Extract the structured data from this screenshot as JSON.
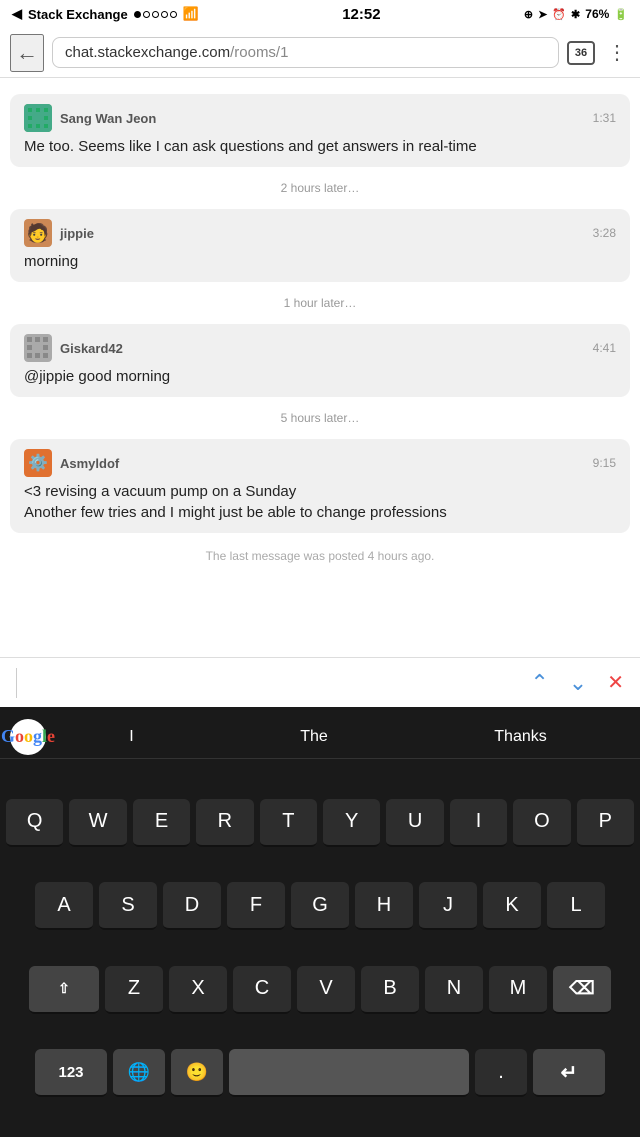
{
  "statusBar": {
    "app": "Stack Exchange",
    "signals": [
      "filled",
      "empty",
      "empty",
      "empty",
      "empty"
    ],
    "wifi": "wifi",
    "time": "12:52",
    "icons_right": [
      "location",
      "navigation",
      "alarm",
      "bluetooth"
    ],
    "battery": "76%"
  },
  "addressBar": {
    "back": "←",
    "url_main": "chat.stackexchange.com",
    "url_rest": "/rooms/1",
    "tab_count": "36",
    "menu": "⋮"
  },
  "chat": {
    "messages": [
      {
        "author": "Sang Wan Jeon",
        "time": "1:31",
        "avatar_type": "sang",
        "lines": [
          "Me too. Seems like I can ask questions and get answers in real-time"
        ]
      },
      {
        "separator": "2 hours later…"
      },
      {
        "author": "jippie",
        "time": "3:28",
        "avatar_type": "jippie",
        "lines": [
          "morning"
        ]
      },
      {
        "separator": "1 hour later…"
      },
      {
        "author": "Giskard42",
        "time": "4:41",
        "avatar_type": "giskard",
        "lines": [
          "@jippie good morning"
        ]
      },
      {
        "separator": "5 hours later…"
      },
      {
        "author": "Asmyldof",
        "time": "9:15",
        "avatar_type": "asmyldof",
        "lines": [
          "<3 revising a vacuum pump on a Sunday",
          "Another few tries and I might just be able to change professions"
        ]
      }
    ],
    "lastMessageNote": "The last message was posted 4 hours ago."
  },
  "toolbar": {
    "up_arrow": "∧",
    "down_arrow": "∨",
    "close": "✕"
  },
  "keyboard": {
    "suggestions": {
      "word1": "I",
      "word2": "The",
      "word3": "Thanks"
    },
    "rows": [
      [
        "Q",
        "W",
        "E",
        "R",
        "T",
        "Y",
        "U",
        "I",
        "O",
        "P"
      ],
      [
        "A",
        "S",
        "D",
        "F",
        "G",
        "H",
        "J",
        "K",
        "L"
      ],
      [
        "⇧",
        "Z",
        "X",
        "C",
        "V",
        "B",
        "N",
        "M",
        "⌫"
      ],
      [
        "123",
        "🌐",
        "😊",
        "",
        ".",
        "↵"
      ]
    ]
  }
}
